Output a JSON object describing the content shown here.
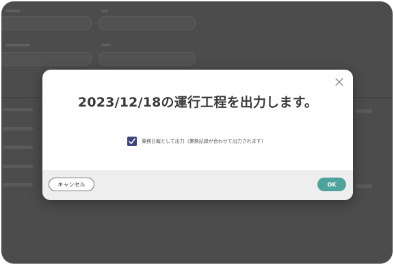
{
  "dialog": {
    "title": "2023/12/18の運行工程を出力します。",
    "option_label": "乗務日報として出力（業務記録が合わせて出力されます）",
    "option_checked": true,
    "cancel_label": "キャンセル",
    "ok_label": "OK"
  },
  "colors": {
    "overlay": "#4c4c4c",
    "checkbox": "#3e4482",
    "ok_button": "#4fa39d",
    "footer": "#eeeeee"
  },
  "icons": {
    "close": "close-icon",
    "check": "check-icon"
  }
}
